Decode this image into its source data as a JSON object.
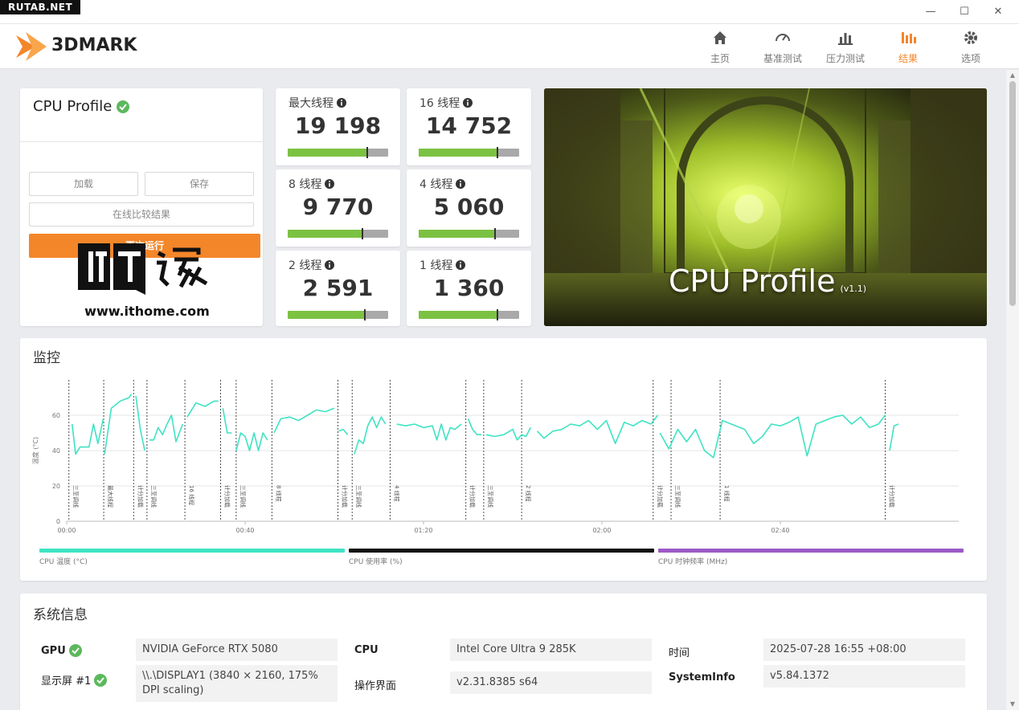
{
  "watermark": "RUTAB.NET",
  "window_controls": {
    "minimize": "—",
    "maximize": "☐",
    "close": "✕"
  },
  "app": {
    "brand": "3DMARK"
  },
  "nav": [
    {
      "label": "主页",
      "icon": "home-icon"
    },
    {
      "label": "基准测试",
      "icon": "gauge-icon"
    },
    {
      "label": "压力测试",
      "icon": "stress-bars-icon"
    },
    {
      "label": "结果",
      "icon": "results-bars-icon",
      "active": true
    },
    {
      "label": "选项",
      "icon": "gear-icon"
    }
  ],
  "accent_color": "#f4862a",
  "profile_panel": {
    "title": "CPU Profile",
    "load_button": "加载",
    "save_button": "保存",
    "compare_button": "在线比较结果",
    "run_again_button": "再次运行",
    "watermark_url": "www.ithome.com",
    "watermark_logo_text": "IT之家"
  },
  "scores": [
    {
      "label": "最大线程",
      "value": "19 198",
      "fill": 0.79,
      "marker": 0.79
    },
    {
      "label": "16 线程",
      "value": "14 752",
      "fill": 0.78,
      "marker": 0.78
    },
    {
      "label": "8 线程",
      "value": "9 770",
      "fill": 0.74,
      "marker": 0.74
    },
    {
      "label": "4 线程",
      "value": "5 060",
      "fill": 0.76,
      "marker": 0.76
    },
    {
      "label": "2 线程",
      "value": "2 591",
      "fill": 0.77,
      "marker": 0.77
    },
    {
      "label": "1 线程",
      "value": "1 360",
      "fill": 0.78,
      "marker": 0.78
    }
  ],
  "hero": {
    "title": "CPU Profile",
    "version": "(v1.1)"
  },
  "monitor": {
    "title": "监控",
    "legend": [
      {
        "label": "CPU 温度 (°C)",
        "color": "#3fe3c3"
      },
      {
        "label": "CPU 使用率 (%)",
        "color": "#111111"
      },
      {
        "label": "CPU 时钟频率 (MHz)",
        "color": "#9b59c6"
      }
    ]
  },
  "chart_data": {
    "type": "line",
    "ylabel": "温度 (°C)",
    "ylim": [
      0,
      80
    ],
    "yticks": [
      0,
      20,
      40,
      60
    ],
    "xticks": [
      "00:00",
      "00:40",
      "01:20",
      "02:00",
      "02:40"
    ],
    "xlim_seconds": [
      0,
      200
    ],
    "grid": true,
    "series": [
      {
        "name": "CPU 温度 (°C)",
        "color": "#3fe3c3",
        "segments": [
          {
            "t": [
              1.2,
              2,
              3,
              4,
              5,
              6,
              7,
              8.2
            ],
            "v": [
              55,
              38,
              42,
              42,
              42,
              55,
              44,
              58
            ]
          },
          {
            "t": [
              8.5,
              10,
              12,
              14,
              14.5
            ],
            "v": [
              38,
              64,
              68,
              70,
              72
            ]
          },
          {
            "t": [
              15.5,
              16.5,
              17.5
            ],
            "v": [
              71,
              52,
              40
            ]
          },
          {
            "t": [
              18.5,
              19.5,
              20.5,
              21.5,
              22.5,
              23.5,
              24.5,
              26
            ],
            "v": [
              46,
              46,
              53,
              49,
              55,
              60,
              45,
              55
            ]
          },
          {
            "t": [
              27,
              29,
              31,
              33,
              34
            ],
            "v": [
              59,
              67,
              65,
              68,
              68
            ]
          },
          {
            "t": [
              35,
              36,
              37
            ],
            "v": [
              64,
              50,
              50
            ]
          },
          {
            "t": [
              38,
              39,
              40,
              41,
              42,
              43,
              44,
              45
            ],
            "v": [
              40,
              50,
              48,
              40,
              50,
              40,
              50,
              46
            ]
          },
          {
            "t": [
              46.5,
              48,
              50,
              52,
              54,
              56,
              58,
              60
            ],
            "v": [
              50,
              58,
              59,
              57,
              60,
              63,
              62,
              64
            ]
          },
          {
            "t": [
              61,
              62,
              63
            ],
            "v": [
              51,
              52,
              49
            ]
          },
          {
            "t": [
              64.5,
              65.5,
              66.5,
              67.5,
              68.5,
              69.5,
              70.5,
              71.5
            ],
            "v": [
              38,
              46,
              44,
              54,
              59,
              53,
              59,
              55
            ]
          },
          {
            "t": [
              74,
              76,
              78,
              80,
              82,
              83,
              84,
              85,
              86,
              87,
              88.5
            ],
            "v": [
              55,
              54,
              55,
              53,
              54,
              46,
              55,
              46,
              53,
              52,
              55
            ]
          },
          {
            "t": [
              90,
              91,
              92,
              93
            ],
            "v": [
              58,
              52,
              49,
              49
            ]
          },
          {
            "t": [
              94,
              96,
              98,
              100,
              101,
              102,
              103,
              104
            ],
            "v": [
              49,
              48,
              49,
              52,
              46,
              49,
              48,
              53
            ]
          },
          {
            "t": [
              105.5,
              107,
              109,
              111,
              113,
              115,
              117,
              119,
              121,
              123,
              125,
              127,
              129,
              131,
              132.5
            ],
            "v": [
              51,
              47,
              51,
              52,
              55,
              54,
              57,
              52,
              57,
              44,
              56,
              54,
              57,
              55,
              60
            ]
          },
          {
            "t": [
              133,
              135,
              137,
              139,
              141,
              143,
              145,
              147,
              149,
              152,
              154,
              156,
              158,
              160,
              162,
              164,
              166,
              168,
              170,
              172,
              174,
              176,
              178,
              180,
              182,
              183.5
            ],
            "v": [
              50,
              41,
              52,
              45,
              52,
              40,
              36,
              57,
              55,
              52,
              44,
              48,
              55,
              54,
              56,
              59,
              37,
              55,
              57,
              59,
              60,
              55,
              59,
              53,
              55,
              60
            ]
          },
          {
            "t": [
              184.5,
              185.5,
              186.5
            ],
            "v": [
              40,
              54,
              55
            ]
          }
        ]
      }
    ],
    "annotations": [
      {
        "t": 0.5,
        "label": "三至调线"
      },
      {
        "t": 8.3,
        "label": "最大线程"
      },
      {
        "t": 15,
        "label": "计分加载"
      },
      {
        "t": 18,
        "label": "三至调线"
      },
      {
        "t": 26.5,
        "label": "16 线程"
      },
      {
        "t": 34.5,
        "label": "计分加载"
      },
      {
        "t": 38,
        "label": "三至调线"
      },
      {
        "t": 46,
        "label": "8 线程"
      },
      {
        "t": 60.8,
        "label": "计分加载"
      },
      {
        "t": 64,
        "label": "三至调线"
      },
      {
        "t": 72.5,
        "label": "4 线程"
      },
      {
        "t": 89.5,
        "label": "计分加载"
      },
      {
        "t": 93.5,
        "label": "三至调线"
      },
      {
        "t": 102,
        "label": "2 线程"
      },
      {
        "t": 131.5,
        "label": "计分加载"
      },
      {
        "t": 135.5,
        "label": "三至调线"
      },
      {
        "t": 146.5,
        "label": "1 线程"
      },
      {
        "t": 183.5,
        "label": "计分加载"
      }
    ]
  },
  "system_info": {
    "title": "系统信息",
    "rows": [
      {
        "label": "GPU",
        "value": "NVIDIA GeForce RTX 5080",
        "ok": true
      },
      {
        "label": "显示屏 #1",
        "value": "\\\\.\\DISPLAY1 (3840 × 2160, 175% DPI scaling)",
        "ok": true
      },
      {
        "label": "CPU",
        "value": "Intel Core Ultra 9 285K"
      },
      {
        "label": "操作界面",
        "value": "v2.31.8385 s64"
      },
      {
        "label": "时间",
        "value": "2025-07-28 16:55 +08:00"
      },
      {
        "label": "SystemInfo",
        "value": "v5.84.1372"
      }
    ]
  }
}
